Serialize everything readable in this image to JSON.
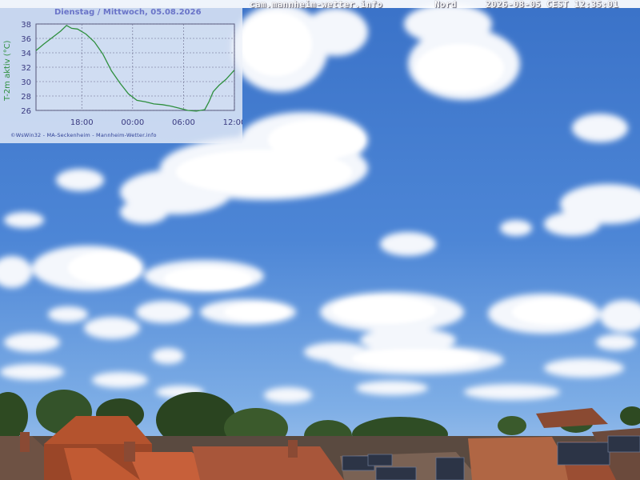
{
  "header": {
    "site": "cam.mannheim-wetter.info",
    "direction": "Nord",
    "timestamp": "2026-08-05 CEST 12:35:01"
  },
  "chart_panel": {
    "title": "Dienstag / Mittwoch, 05.08.2026",
    "credit": "©WsWin32 - MA-Seckenheim - Mannheim-Wetter.info"
  },
  "chart_data": {
    "type": "line",
    "title": "Dienstag / Mittwoch, 05.08.2026",
    "ylabel": "T-2m aktiv (°C)",
    "xlabel": "",
    "ylim": [
      26,
      38
    ],
    "yticks": [
      26,
      28,
      30,
      32,
      34,
      36,
      38
    ],
    "xticks": [
      {
        "label": "18:00",
        "hour": 18
      },
      {
        "label": "00:00",
        "hour": 24
      },
      {
        "label": "06:00",
        "hour": 30
      },
      {
        "label": "12:00",
        "hour": 36
      }
    ],
    "xlim": [
      12.6,
      36
    ],
    "grid": true,
    "series": [
      {
        "color": "#2e8f3e",
        "points": [
          [
            12.6,
            34.3
          ],
          [
            13.5,
            35.2
          ],
          [
            14.5,
            36.1
          ],
          [
            15.5,
            37.0
          ],
          [
            16.2,
            37.8
          ],
          [
            16.8,
            37.4
          ],
          [
            17.5,
            37.3
          ],
          [
            18.5,
            36.6
          ],
          [
            19.5,
            35.5
          ],
          [
            20.5,
            33.8
          ],
          [
            21.5,
            31.5
          ],
          [
            22.5,
            29.8
          ],
          [
            23.5,
            28.3
          ],
          [
            24.5,
            27.4
          ],
          [
            25.5,
            27.2
          ],
          [
            26.5,
            26.9
          ],
          [
            27.5,
            26.8
          ],
          [
            28.5,
            26.6
          ],
          [
            29.5,
            26.3
          ],
          [
            30.5,
            26.0
          ],
          [
            31.5,
            25.9
          ],
          [
            32.5,
            26.1
          ],
          [
            33.0,
            27.2
          ],
          [
            33.5,
            28.6
          ],
          [
            34.2,
            29.5
          ],
          [
            35.0,
            30.3
          ],
          [
            36.0,
            31.6
          ]
        ]
      }
    ]
  }
}
